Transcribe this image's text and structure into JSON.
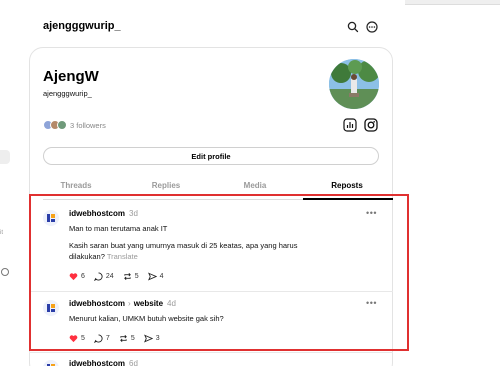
{
  "header": {
    "username": "ajengggwurip_"
  },
  "profile": {
    "display_name": "AjengW",
    "handle": "ajengggwurip_",
    "followers_text": "3 followers",
    "edit_button": "Edit profile"
  },
  "tabs": [
    {
      "label": "Threads",
      "active": false
    },
    {
      "label": "Replies",
      "active": false
    },
    {
      "label": "Media",
      "active": false
    },
    {
      "label": "Reposts",
      "active": true
    }
  ],
  "posts": [
    {
      "author": "idwebhostcom",
      "time": "3d",
      "line1": "Man to man terutama anak IT",
      "line2": "Kasih saran buat yang umurnya masuk di 25 keatas, apa yang harus",
      "line3": "dilakukan?",
      "translate": "Translate",
      "likes": "6",
      "comments": "24",
      "reposts": "5",
      "shares": "4"
    },
    {
      "author": "idwebhostcom",
      "community": "website",
      "time": "4d",
      "line1": "Menurut kalian, UMKM butuh website gak sih?",
      "likes": "5",
      "comments": "7",
      "reposts": "5",
      "shares": "3"
    },
    {
      "author": "idwebhostcom",
      "time": "6d"
    }
  ],
  "colors": {
    "like": "#ff3040",
    "highlight": "#e03030",
    "brand_blue": "#2b3ea8",
    "brand_orange": "#f6a21a"
  },
  "icons": [
    "search-icon",
    "more-circle-icon",
    "insights-icon",
    "instagram-icon",
    "heart-icon",
    "comment-icon",
    "repost-icon",
    "share-icon"
  ]
}
